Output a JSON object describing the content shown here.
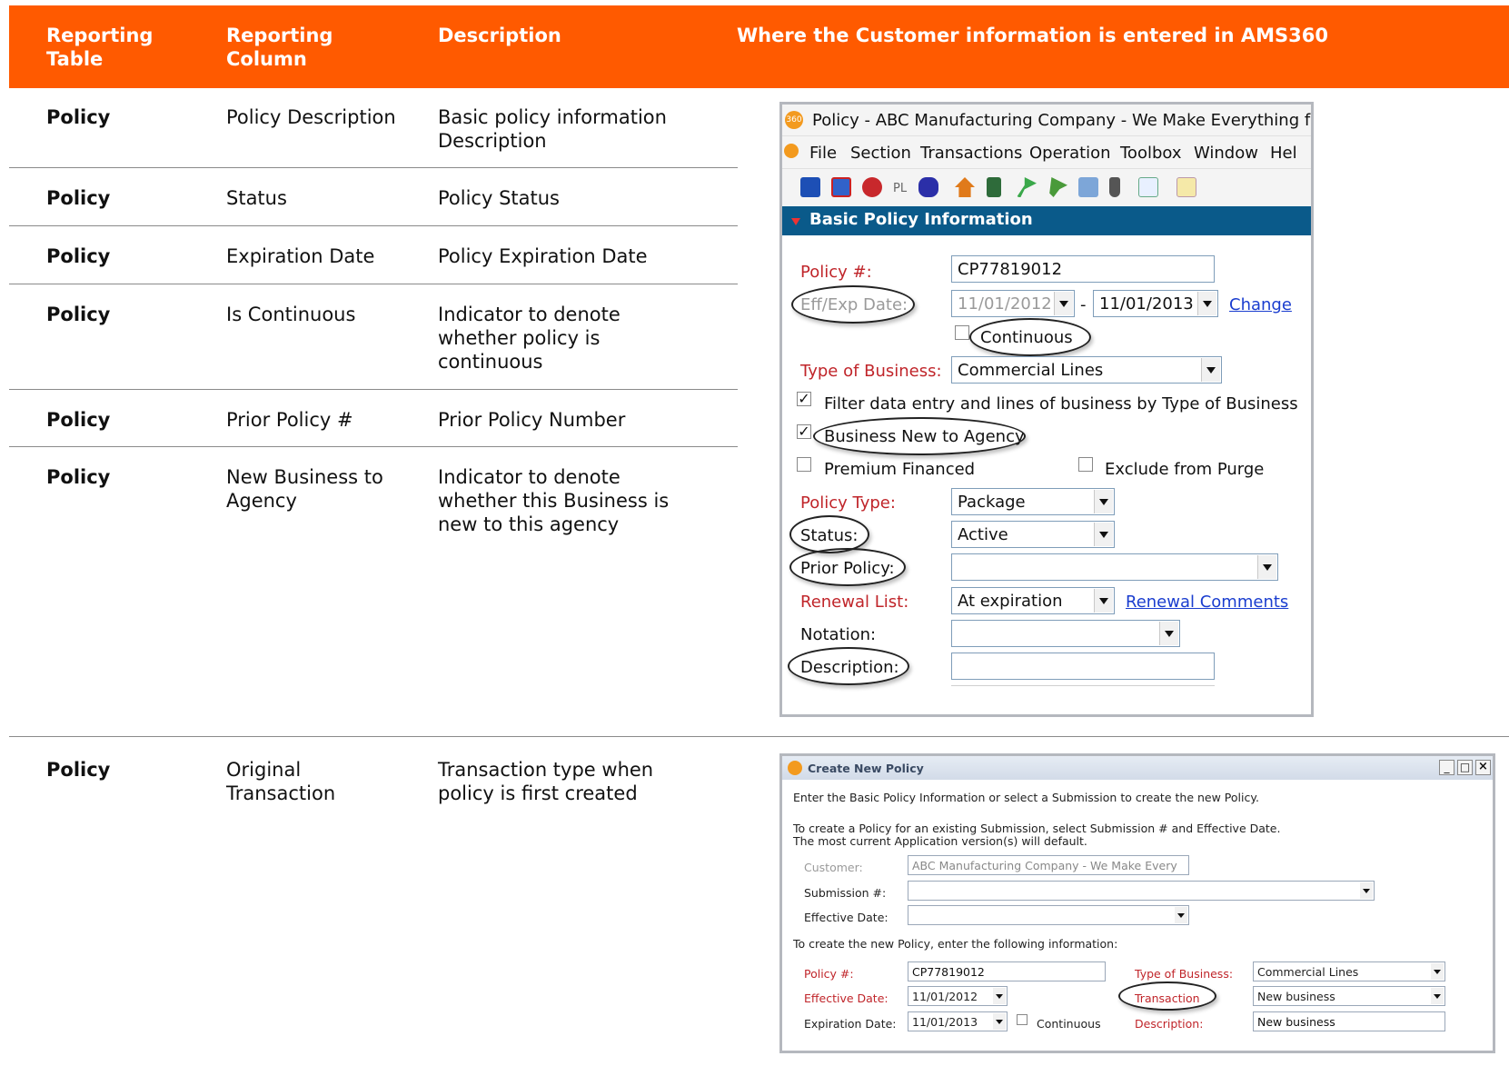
{
  "header": {
    "col_table": "Reporting Table",
    "col_column": "Reporting Column",
    "col_description": "Description",
    "col_where": "Where the Customer information is entered in AMS360",
    "color": "#ff5a00"
  },
  "rows": [
    {
      "table": "Policy",
      "column": "Policy Description",
      "description": "Basic policy information Description"
    },
    {
      "table": "Policy",
      "column": "Status",
      "description": "Policy Status"
    },
    {
      "table": "Policy",
      "column": "Expiration Date",
      "description": "Policy Expiration Date"
    },
    {
      "table": "Policy",
      "column": "Is Continuous",
      "description": "Indicator to denote whether policy is continuous"
    },
    {
      "table": "Policy",
      "column": "Prior Policy #",
      "description": "Prior Policy Number"
    },
    {
      "table": "Policy",
      "column": "New Business to Agency",
      "description": "Indicator to denote whether this Business is new to this agency"
    },
    {
      "table": "Policy",
      "column": "Original Transaction",
      "description": "Transaction type when policy is first created"
    }
  ],
  "policy_window": {
    "title": "Policy - ABC Manufacturing Company - We Make Everything fror",
    "menu": [
      "File",
      "Section",
      "Transactions",
      "Operation",
      "Toolbox",
      "Window",
      "Hel"
    ],
    "section_title": "Basic Policy Information",
    "policy_no_label": "Policy #:",
    "policy_no_value": "CP77819012",
    "eff_exp_label": "Eff/Exp Date:",
    "eff_date": "11/01/2012",
    "exp_date": "11/01/2013",
    "date_separator": "-",
    "change_link": "Change",
    "continuous_label": "Continuous",
    "type_of_business_label": "Type of Business:",
    "type_of_business_value": "Commercial Lines",
    "filter_label": "Filter data entry and lines of business by Type of Business",
    "business_new_label": "Business New to Agency",
    "premium_financed_label": "Premium Financed",
    "exclude_purge_label": "Exclude from Purge",
    "policy_type_label": "Policy Type:",
    "policy_type_value": "Package",
    "status_label": "Status:",
    "status_value": "Active",
    "prior_policy_label": "Prior Policy:",
    "prior_policy_value": "",
    "renewal_list_label": "Renewal List:",
    "renewal_list_value": "At expiration",
    "renewal_comments_link": "Renewal Comments",
    "notation_label": "Notation:",
    "notation_value": "",
    "description_label": "Description:",
    "description_value": "",
    "section_bar_color": "#0a5a8a",
    "checks": {
      "continuous": false,
      "filter": true,
      "business_new": true,
      "premium_financed": false,
      "exclude_purge": false
    }
  },
  "create_window": {
    "title": "Create New Policy",
    "controls": [
      "_",
      "□",
      "×"
    ],
    "intro": "Enter the Basic Policy Information or select a Submission to create the new Policy.",
    "submission_note_1": "To create a Policy for an existing Submission, select Submission # and Effective Date.",
    "submission_note_2": "The most current Application version(s) will default.",
    "customer_label": "Customer:",
    "customer_value": "ABC Manufacturing Company - We Make Every",
    "submission_label": "Submission #:",
    "submission_value": "",
    "effective_label": "Effective Date:",
    "effective_value": "",
    "new_policy_note": "To create the new Policy, enter the following information:",
    "policy_no_label": "Policy #:",
    "policy_no_value": "CP77819012",
    "eff_date_label": "Effective Date:",
    "eff_date_value": "11/01/2012",
    "exp_date_label": "Expiration Date:",
    "exp_date_value": "11/01/2013",
    "continuous_label": "Continuous",
    "type_of_business_label": "Type of Business:",
    "type_of_business_value": "Commercial Lines",
    "transaction_label": "Transaction",
    "transaction_value": "New business",
    "description_label": "Description:",
    "description_value": "New business"
  }
}
